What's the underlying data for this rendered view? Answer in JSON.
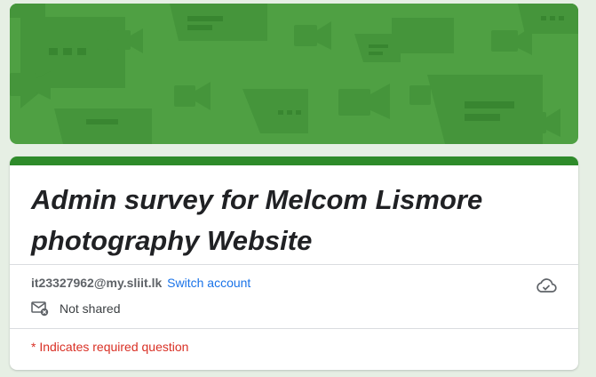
{
  "form": {
    "title": "Admin survey for Melcom Lismore photography Website",
    "account": {
      "email": "it23327962@my.sliit.lk",
      "switch_label": "Switch account",
      "share_status": "Not shared"
    },
    "required_note": "* Indicates required question"
  },
  "colors": {
    "banner": "#4fa043",
    "accent_bar": "#2e8b2a",
    "link": "#1a73e8",
    "required": "#d93025"
  },
  "icons": {
    "banner": "chat-video-pattern",
    "share": "mail-not-shared-icon",
    "cloud": "cloud-saved-icon"
  }
}
